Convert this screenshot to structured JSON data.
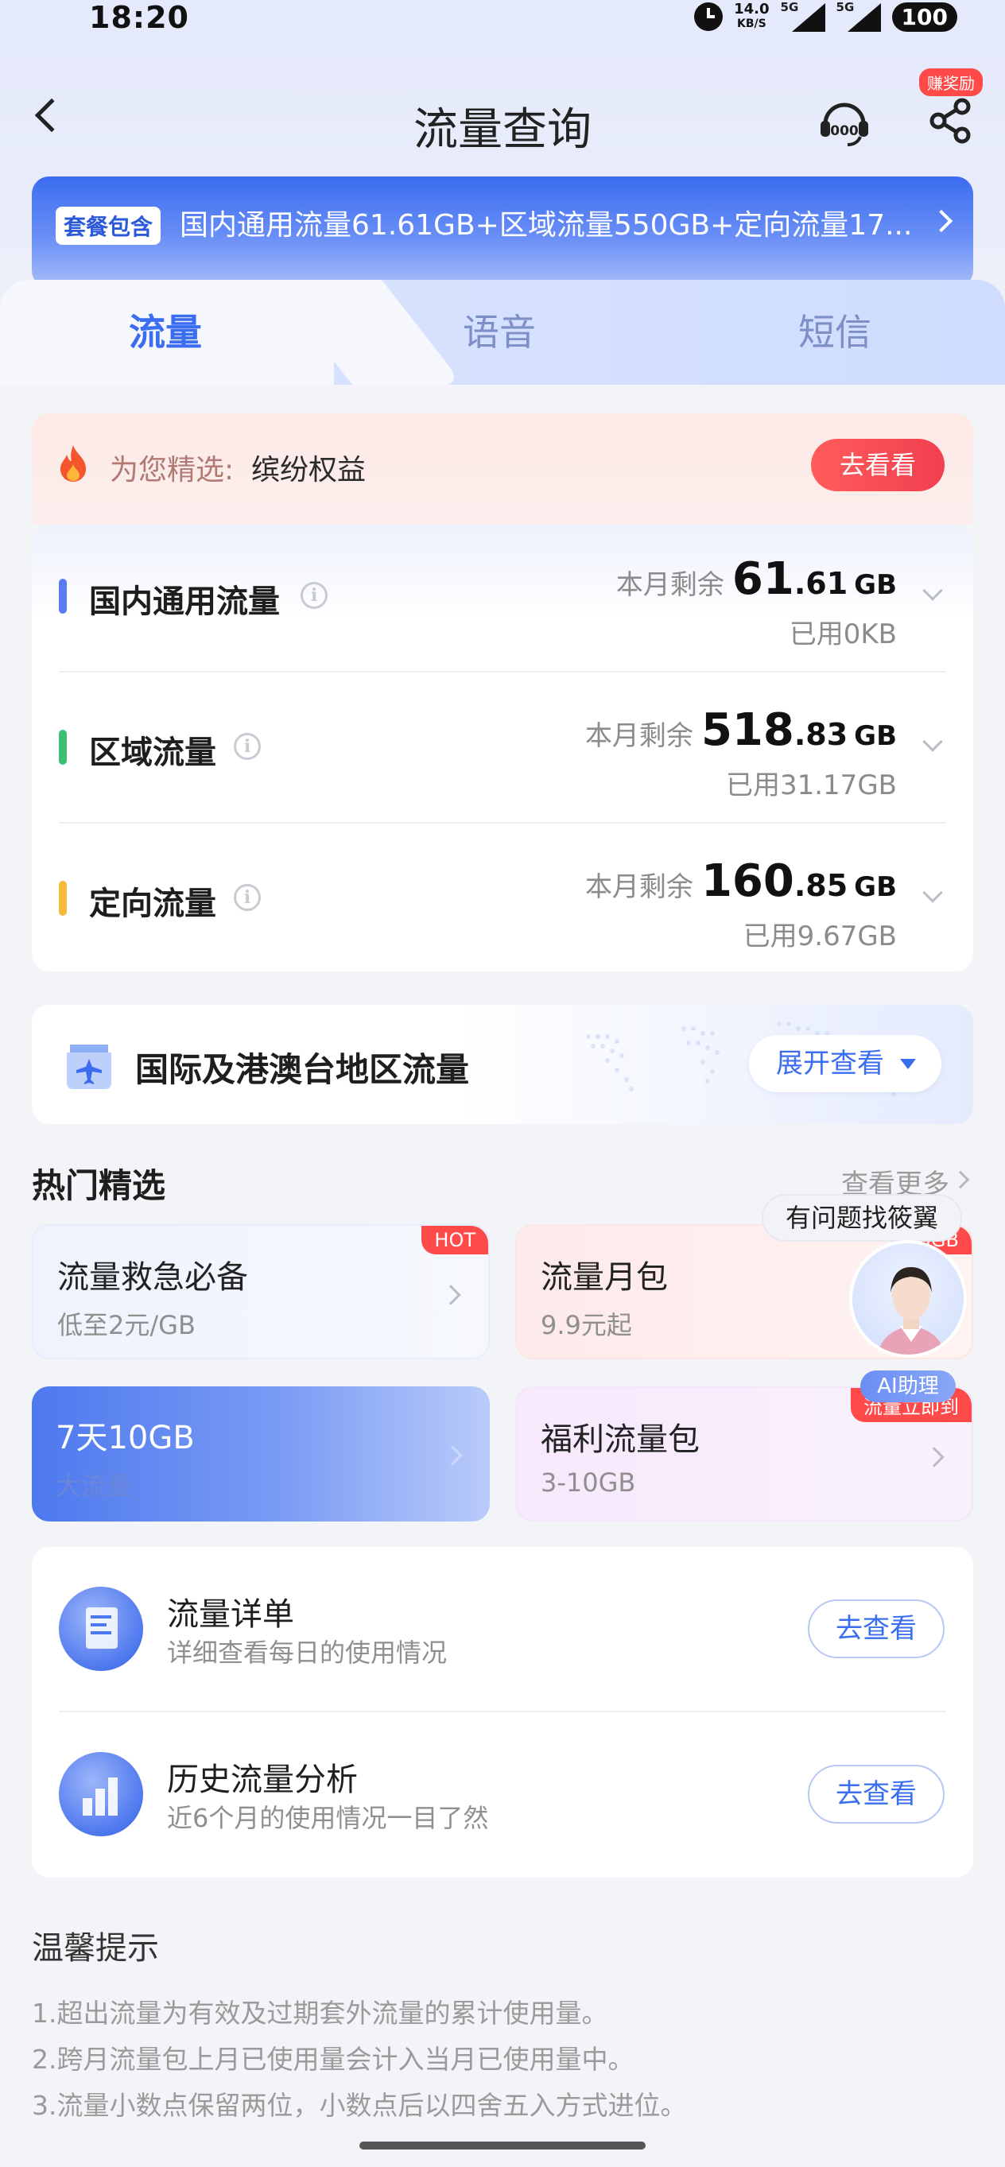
{
  "status_bar": {
    "time": "18:20",
    "net_speed": "14.0",
    "net_unit": "KB/S",
    "sig1_label": "5G",
    "sig2_label": "5G",
    "battery": "100"
  },
  "nav": {
    "title": "流量查询",
    "reward_badge": "赚奖励",
    "service_icon": "customer-service-10000-icon",
    "share_icon": "share-icon"
  },
  "plan_banner": {
    "tag": "套餐包含",
    "text": "国内通用流量61.61GB+区域流量550GB+定向流量17..."
  },
  "tabs": [
    {
      "label": "流量",
      "active": true
    },
    {
      "label": "语音",
      "active": false
    },
    {
      "label": "短信",
      "active": false
    }
  ],
  "recommend": {
    "label": "为您精选:",
    "value": "缤纷权益",
    "button": "去看看"
  },
  "data_usage": [
    {
      "name": "国内通用流量",
      "remain_label": "本月剩余",
      "remain_int": "61",
      "remain_dec": ".61",
      "unit": "GB",
      "used": "已用0KB",
      "color": "#5b7cf0"
    },
    {
      "name": "区域流量",
      "remain_label": "本月剩余",
      "remain_int": "518",
      "remain_dec": ".83",
      "unit": "GB",
      "used": "已用31.17GB",
      "color": "#3cbf73"
    },
    {
      "name": "定向流量",
      "remain_label": "本月剩余",
      "remain_int": "160",
      "remain_dec": ".85",
      "unit": "GB",
      "used": "已用9.67GB",
      "color": "#f5b93c"
    }
  ],
  "intl": {
    "title": "国际及港澳台地区流量",
    "button": "展开查看"
  },
  "hot": {
    "title": "热门精选",
    "more": "查看更多",
    "cards": [
      {
        "title": "流量救急必备",
        "sub": "低至2元/GB",
        "badge": "HOT"
      },
      {
        "title": "流量月包",
        "sub": "9.9元起",
        "badge": "5GB"
      },
      {
        "title": "7天10GB",
        "sub": "大流量",
        "badge": ""
      },
      {
        "title": "福利流量包",
        "sub": "3-10GB",
        "badge": "流量立即到"
      }
    ]
  },
  "assistant": {
    "bubble": "有问题找筱翼",
    "label": "AI助理"
  },
  "services": [
    {
      "title": "流量详单",
      "sub": "详细查看每日的使用情况",
      "button": "去查看"
    },
    {
      "title": "历史流量分析",
      "sub": "近6个月的使用情况一目了然",
      "button": "去查看"
    }
  ],
  "tips": {
    "title": "温馨提示",
    "items": [
      "1.超出流量为有效及过期套外流量的累计使用量。",
      "2.跨月流量包上月已使用量会计入当月已使用量中。",
      "3.流量小数点保留两位，小数点后以四舍五入方式进位。"
    ]
  }
}
